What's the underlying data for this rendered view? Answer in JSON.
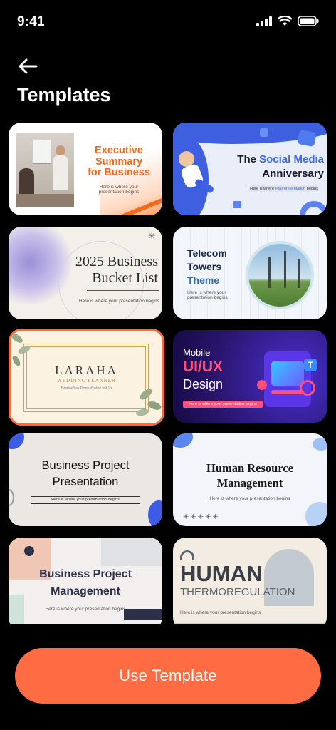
{
  "status": {
    "time": "9:41"
  },
  "header": {
    "title": "Templates"
  },
  "templates": [
    {
      "title_line1": "Executive",
      "title_line2": "Summary",
      "title_line3": "for Business",
      "subtitle_line1": "Here is where your",
      "subtitle_line2": "presentation begins"
    },
    {
      "title_part1": "The ",
      "title_part2": "Social Media",
      "title_line2": "Anniversary",
      "subtitle_part1": "Here is where ",
      "subtitle_part2": "your presentation",
      "subtitle_part3": " begins"
    },
    {
      "title_line1": "2025 Business",
      "title_line2": "Bucket List",
      "subtitle": "Here is where your presentation begins"
    },
    {
      "title_line1": "Telecom",
      "title_line2": "Towers",
      "title_line3": "Theme",
      "subtitle_line1": "Here is where your",
      "subtitle_line2": "presentation begins"
    },
    {
      "title": "LARAHA",
      "subtitle": "WEDDING PLANNER",
      "tagline": "Planning Your Dream Wedding with Us"
    },
    {
      "title_line1": "Mobile",
      "title_line2": "UI/UX",
      "title_line3": "Design",
      "subtitle": "Here is where your presentation begins"
    },
    {
      "title_line1": "Business Project",
      "title_line2": "Presentation",
      "subtitle": "Here is where your presentation begins"
    },
    {
      "title_line1": "Human Resource",
      "title_line2": "Management",
      "subtitle": "Here is where your presentation begins"
    },
    {
      "title_line1": "Business Project",
      "title_line2": "Management",
      "subtitle": "Here is where your presentation begins"
    },
    {
      "title_line1": "HUMAN",
      "title_line2": "THERMOREGULATION",
      "subtitle": "Here is where your presentation begins"
    }
  ],
  "actions": {
    "use_template": "Use Template"
  },
  "colors": {
    "accent": "#ff6b43",
    "background": "#000000"
  }
}
